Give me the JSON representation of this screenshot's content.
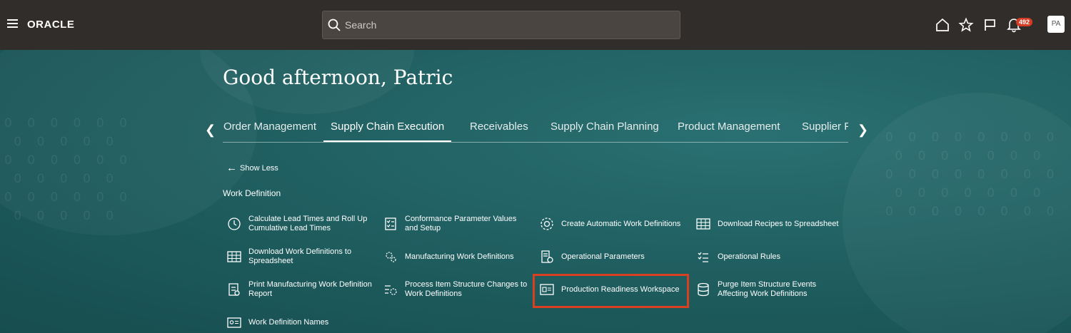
{
  "header": {
    "brand": "ORACLE",
    "search_placeholder": "Search",
    "notification_count": "492",
    "avatar_initials": "PA",
    "icons": [
      "menu-icon",
      "home-icon",
      "star-icon",
      "flag-icon",
      "bell-icon"
    ]
  },
  "greeting": "Good afternoon, Patric",
  "tabs": [
    {
      "label": "Order Management"
    },
    {
      "label": "Supply Chain Execution",
      "active": true
    },
    {
      "label": "Receivables"
    },
    {
      "label": "Supply Chain Planning"
    },
    {
      "label": "Product Management"
    },
    {
      "label": "Supplier Po"
    }
  ],
  "show_less_label": "Show Less",
  "section_title": "Work Definition",
  "tasks": [
    {
      "label": "Calculate Lead Times and Roll Up Cumulative Lead Times",
      "icon": "clock-history-icon"
    },
    {
      "label": "Conformance Parameter Values and Setup",
      "icon": "checklist-icon"
    },
    {
      "label": "Create Automatic Work Definitions",
      "icon": "auto-settings-icon"
    },
    {
      "label": "Download Recipes to Spreadsheet",
      "icon": "spreadsheet-icon"
    },
    {
      "label": "Download Work Definitions to Spreadsheet",
      "icon": "spreadsheet-icon"
    },
    {
      "label": "Manufacturing Work Definitions",
      "icon": "gears-icon"
    },
    {
      "label": "Operational Parameters",
      "icon": "document-settings-icon"
    },
    {
      "label": "Operational Rules",
      "icon": "rules-list-icon"
    },
    {
      "label": "Print Manufacturing Work Definition Report",
      "icon": "report-icon"
    },
    {
      "label": "Process Item Structure Changes to Work Definitions",
      "icon": "structure-settings-icon"
    },
    {
      "label": "Production Readiness Workspace",
      "icon": "workspace-icon",
      "highlighted": true
    },
    {
      "label": "Purge Item Structure Events Affecting Work Definitions",
      "icon": "database-icon"
    },
    {
      "label": "Work Definition Names",
      "icon": "id-card-icon"
    }
  ],
  "colors": {
    "topbar": "#312d2a",
    "background": "#1f5e60",
    "highlight": "#d9401f",
    "badge": "#d63b25"
  }
}
